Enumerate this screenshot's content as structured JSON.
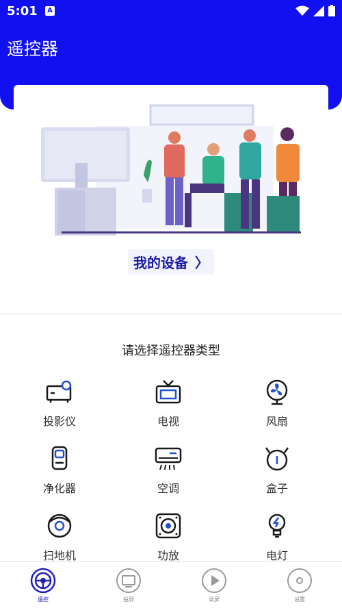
{
  "status_bar": {
    "time": "5:01",
    "app_icon": "A"
  },
  "header": {
    "title": "遥控器"
  },
  "card": {
    "my_devices_label": "我的设备",
    "chevron": "〉"
  },
  "section": {
    "title": "请选择遥控器类型"
  },
  "remote_types": [
    {
      "label": "投影仪",
      "icon": "projector-icon"
    },
    {
      "label": "电视",
      "icon": "tv-icon"
    },
    {
      "label": "风扇",
      "icon": "fan-icon"
    },
    {
      "label": "净化器",
      "icon": "purifier-icon"
    },
    {
      "label": "空调",
      "icon": "air-conditioner-icon"
    },
    {
      "label": "盒子",
      "icon": "set-top-box-icon"
    },
    {
      "label": "扫地机",
      "icon": "robot-vacuum-icon"
    },
    {
      "label": "功放",
      "icon": "amplifier-icon"
    },
    {
      "label": "电灯",
      "icon": "light-bulb-icon"
    }
  ],
  "tabs": [
    {
      "label": "遥控",
      "icon": "steering-remote-icon",
      "active": true
    },
    {
      "label": "投屏",
      "icon": "screen-cast-icon",
      "active": false
    },
    {
      "label": "录屏",
      "icon": "screen-record-icon",
      "active": false
    },
    {
      "label": "设置",
      "icon": "settings-disc-icon",
      "active": false
    }
  ],
  "colors": {
    "primary": "#1010f0",
    "accent_text": "#1a1aa6",
    "icon": "#1a1a1a"
  }
}
